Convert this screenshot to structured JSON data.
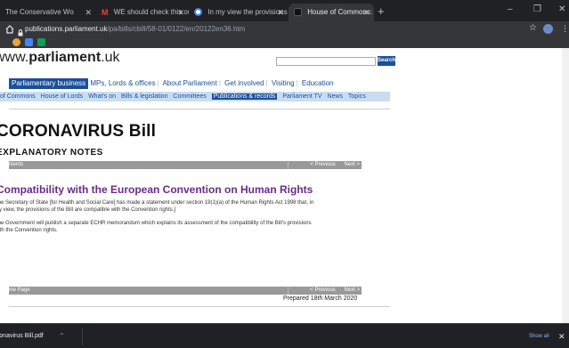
{
  "browser": {
    "tabs": [
      {
        "title": "The Conservative Wo",
        "active": false,
        "fav_color": "#1b75bb"
      },
      {
        "title": "WE should check this out - sent",
        "active": false,
        "fav_color": "#d93025"
      },
      {
        "title": "In my view the provisions of the",
        "active": false,
        "fav_color": "#4285f4"
      },
      {
        "title": "House of Commons: CORONAVIR",
        "active": true,
        "fav_color": "#000000"
      }
    ],
    "new_tab": "+",
    "window_controls": {
      "minimize": "–",
      "restore": "❐",
      "close": "✕"
    },
    "url_domain": "publications.parliament.uk",
    "url_path": "/pa/bills/cbill/58-01/0122/en/20122en36.htm",
    "icons": {
      "home": "home-icon",
      "lock": "lock-icon",
      "star": "star-icon",
      "menu": "menu-icon"
    }
  },
  "site": {
    "logo_prefix": "www.",
    "logo_main": "parliament",
    "logo_suffix": ".uk",
    "search_label": "Search"
  },
  "nav1": [
    "Parliamentary business",
    "MPs, Lords & offices",
    "About Parliament",
    "Get involved",
    "Visiting",
    "Education"
  ],
  "nav2": [
    "of Commons",
    "House of Lords",
    "What's on",
    "Bills & legislation",
    "Committees",
    "Publications & records",
    "Parliament TV",
    "News",
    "Topics"
  ],
  "nav2_selected": "Publications & records",
  "content": {
    "title": "CORONAVIRUS Bill",
    "subtitle": "EXPLANATORY NOTES",
    "bar_top_left": "Contents",
    "bar_bottom_left": "Home Page",
    "previous": "< Previous",
    "next": "Next >",
    "heading": "Compatibility with the European Convention on Human Rights",
    "para1_line1": "The Secretary of State [for Health and Social Care] has made a statement under section 19(1)(a) of the Human Rights Act 1998 that, in",
    "para1_line2": "my view, the provisions of the Bill are compatible with the Convention rights.]",
    "para2_line1": "The Government will publish a separate ECHR memorandum which explains its assessment of the compatibility of the Bill's provisions",
    "para2_line2": "with the Convention rights.",
    "prepared": "Prepared 18th March 2020"
  },
  "downloads": {
    "file": "Coronavirus Bill.pdf",
    "show_all": "Show all",
    "close": "✕"
  }
}
